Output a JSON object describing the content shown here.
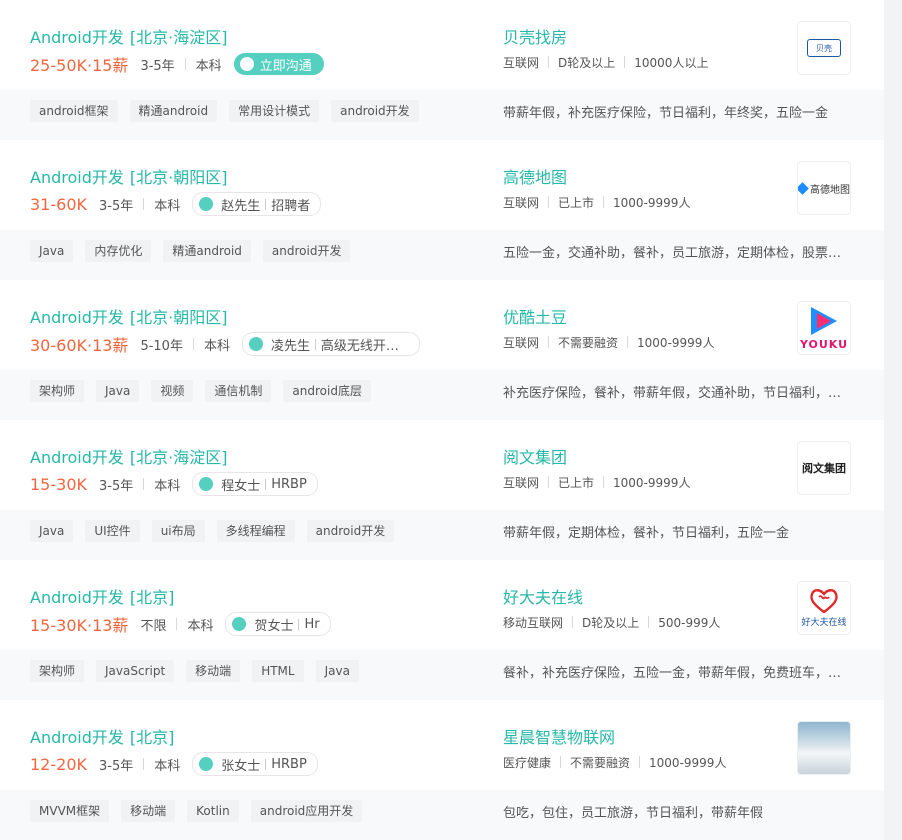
{
  "jobs": [
    {
      "title": "Android开发",
      "location": "[北京·海淀区]",
      "salary": "25-50K·15薪",
      "experience": "3-5年",
      "education": "本科",
      "chat_label": "立即沟通",
      "tags": [
        "android框架",
        "精通android",
        "常用设计模式",
        "android开发"
      ],
      "company": "贝壳找房",
      "industry": "互联网",
      "stage": "D轮及以上",
      "size": "10000人以上",
      "benefits": "带薪年假，补充医疗保险，节日福利，年终奖，五险一金",
      "logo_text": "贝壳",
      "logo_icon": "beike-logo"
    },
    {
      "title": "Android开发",
      "location": "[北京·朝阳区]",
      "salary": "31-60K",
      "experience": "3-5年",
      "education": "本科",
      "recruiter_name": "赵先生",
      "recruiter_role": "招聘者",
      "tags": [
        "Java",
        "内存优化",
        "精通android",
        "android开发"
      ],
      "company": "高德地图",
      "industry": "互联网",
      "stage": "已上市",
      "size": "1000-9999人",
      "benefits": "五险一金，交通补助，餐补，员工旅游，定期体检，股票期权",
      "logo_text": "高德地图",
      "logo_icon": "amap-logo"
    },
    {
      "title": "Android开发",
      "location": "[北京·朝阳区]",
      "salary": "30-60K·13薪",
      "experience": "5-10年",
      "education": "本科",
      "recruiter_name": "凌先生",
      "recruiter_role": "高级无线开发经理",
      "tags": [
        "架构师",
        "Java",
        "视频",
        "通信机制",
        "android底层"
      ],
      "company": "优酷土豆",
      "industry": "互联网",
      "stage": "不需要融资",
      "size": "1000-9999人",
      "benefits": "补充医疗保险，餐补，带薪年假，交通补助，节日福利，五险一金",
      "logo_text": "YOUKU",
      "logo_icon": "youku-logo"
    },
    {
      "title": "Android开发",
      "location": "[北京·海淀区]",
      "salary": "15-30K",
      "experience": "3-5年",
      "education": "本科",
      "recruiter_name": "程女士",
      "recruiter_role": "HRBP",
      "tags": [
        "Java",
        "UI控件",
        "ui布局",
        "多线程编程",
        "android开发"
      ],
      "company": "阅文集团",
      "industry": "互联网",
      "stage": "已上市",
      "size": "1000-9999人",
      "benefits": "带薪年假，定期体检，餐补，节日福利，五险一金",
      "logo_text": "阅文集团",
      "logo_icon": "yuewen-logo"
    },
    {
      "title": "Android开发",
      "location": "[北京]",
      "salary": "15-30K·13薪",
      "experience": "不限",
      "education": "本科",
      "recruiter_name": "贺女士",
      "recruiter_role": "Hr",
      "tags": [
        "架构师",
        "JavaScript",
        "移动端",
        "HTML",
        "Java"
      ],
      "company": "好大夫在线",
      "industry": "移动互联网",
      "stage": "D轮及以上",
      "size": "500-999人",
      "benefits": "餐补，补充医疗保险，五险一金，带薪年假，免费班车，年终奖",
      "logo_text": "好大夫在线",
      "logo_icon": "haodf-logo"
    },
    {
      "title": "Android开发",
      "location": "[北京]",
      "salary": "12-20K",
      "experience": "3-5年",
      "education": "本科",
      "recruiter_name": "张女士",
      "recruiter_role": "HRBP",
      "tags": [
        "MVVM框架",
        "移动端",
        "Kotlin",
        "android应用开发"
      ],
      "company": "星晨智慧物联网",
      "industry": "医疗健康",
      "stage": "不需要融资",
      "size": "1000-9999人",
      "benefits": "包吃，包住，员工旅游，节日福利，带薪年假",
      "logo_text": "",
      "logo_icon": "company-photo-logo"
    }
  ],
  "colors": {
    "accent": "#26b8a8",
    "salary": "#f2663f",
    "chat_button": "#55cfc0"
  }
}
